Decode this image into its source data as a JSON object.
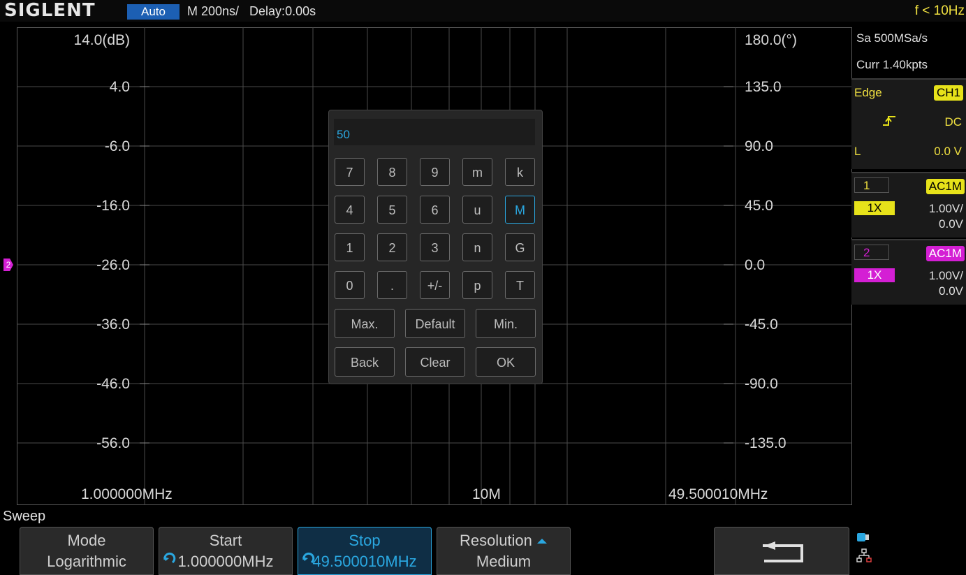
{
  "topbar": {
    "logo": "SIGLENT",
    "trigger_mode": "Auto",
    "timebase": "M 200ns/   Delay:0.00s",
    "frequency_counter": "f < 10Hz"
  },
  "plot": {
    "y_left_ticks": [
      "14.0(dB)",
      "4.0",
      "-6.0",
      "-16.0",
      "-26.0",
      "-36.0",
      "-46.0",
      "-56.0"
    ],
    "y_right_ticks": [
      "180.0(°)",
      "135.0",
      "90.0",
      "45.0",
      "0.0",
      "-45.0",
      "-90.0",
      "-135.0"
    ],
    "x_labels": [
      "1.000000MHz",
      "10M",
      "49.500010MHz"
    ],
    "ch2_marker": "2"
  },
  "side_panel": {
    "sample_rate": "Sa 500MSa/s",
    "curr_points": "Curr 1.40kpts",
    "trigger": {
      "type": "Edge",
      "source": "CH1",
      "slope_icon": "rising-edge-icon",
      "coupling": "DC",
      "level_label": "L",
      "level_value": "0.0 V"
    },
    "ch1": {
      "num": "1",
      "coupling": "AC1M",
      "probe": "1X",
      "scale": "1.00V/",
      "offset": "0.0V"
    },
    "ch2": {
      "num": "2",
      "coupling": "AC1M",
      "probe": "1X",
      "scale": "1.00V/",
      "offset": "0.0V"
    }
  },
  "keypad": {
    "entry": "50",
    "rows": [
      [
        "7",
        "8",
        "9",
        "m",
        "k"
      ],
      [
        "4",
        "5",
        "6",
        "u",
        "M"
      ],
      [
        "1",
        "2",
        "3",
        "n",
        "G"
      ],
      [
        "0",
        ".",
        "+/-",
        "p",
        "T"
      ]
    ],
    "selected": "M",
    "fn_row1": [
      "Max.",
      "Default",
      "Min."
    ],
    "fn_row2": [
      "Back",
      "Clear",
      "OK"
    ]
  },
  "bottom": {
    "menu_title": "Sweep",
    "softkeys": [
      {
        "label": "Mode",
        "value": "Logarithmic"
      },
      {
        "label": "Start",
        "value": "1.000000MHz"
      },
      {
        "label": "Stop",
        "value": "49.500010MHz"
      },
      {
        "label": "Resolution",
        "value": "Medium"
      }
    ],
    "back_icon": "return-arrow-icon",
    "status_icons": [
      "usb-drive-icon",
      "network-icon"
    ]
  },
  "colors": {
    "accent": "#2aa7e0",
    "ch1": "#e7e21a",
    "ch2": "#d41fd4",
    "trigger_mode_bg": "#1c5fb3",
    "counter": "#f0e040"
  }
}
